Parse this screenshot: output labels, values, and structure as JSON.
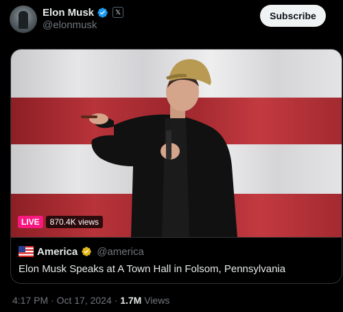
{
  "author": {
    "name": "Elon Musk",
    "handle": "@elonmusk",
    "badge_glyph": "𝕏",
    "verified_color": "#1d9bf0"
  },
  "subscribe_label": "Subscribe",
  "media": {
    "live_label": "LIVE",
    "views_label": "870.4K views",
    "live_color": "#f91880"
  },
  "card": {
    "source_name": "America",
    "source_handle": "@america",
    "title": "Elon Musk Speaks at A Town Hall in Folsom, Pennsylvania",
    "source_check_color": "#e2b719"
  },
  "meta": {
    "time": "4:17 PM",
    "separator": " · ",
    "date": "Oct 17, 2024",
    "separator2": " · ",
    "views_count": "1.7M",
    "views_label": " Views"
  }
}
